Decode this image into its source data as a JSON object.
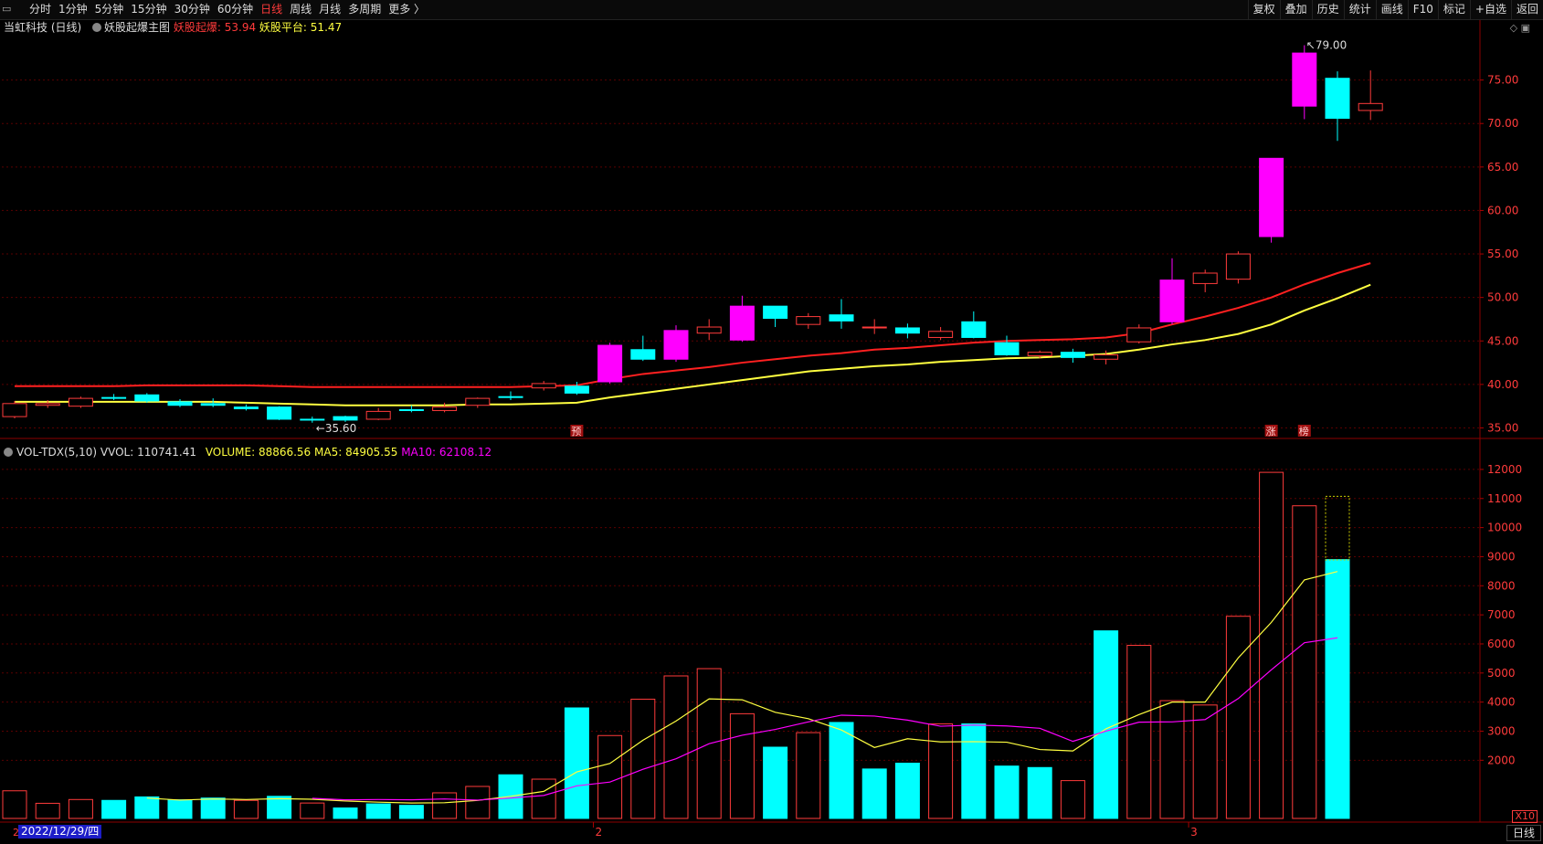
{
  "toolbar": {
    "periods": [
      "分时",
      "1分钟",
      "5分钟",
      "15分钟",
      "30分钟",
      "60分钟",
      "日线",
      "周线",
      "月线",
      "多周期",
      "更多 〉"
    ],
    "active_period": "日线",
    "right_tools": [
      "复权",
      "叠加",
      "历史",
      "统计",
      "画线",
      "F10",
      "标记",
      "+自选",
      "返回"
    ]
  },
  "main_legend": {
    "stock": "当虹科技 (日线)",
    "indicator": "妖股起爆主图",
    "line1_label": "妖股起爆:",
    "line1_value": "53.94",
    "line2_label": "妖股平台:",
    "line2_value": "51.47"
  },
  "volume_legend": {
    "name": "VOL-TDX(5,10)",
    "vvol_label": "VVOL:",
    "vvol_value": "110741.41",
    "volume_label": "VOLUME:",
    "volume_value": "88866.56",
    "ma5_label": "MA5:",
    "ma5_value": "84905.55",
    "ma10_label": "MA10:",
    "ma10_value": "62108.12"
  },
  "colors": {
    "up": "#ff3b3b",
    "down": "#00ffff",
    "big_up": "#ff00ff",
    "line1": "#ff2020",
    "line2": "#ffff40",
    "ma10": "#ff00ff"
  },
  "chart_data": [
    {
      "type": "candlestick",
      "title": "当虹科技 (日线)",
      "y_ticks": [
        "75.00",
        "70.00",
        "65.00",
        "60.00",
        "55.00",
        "50.00",
        "45.00",
        "40.00",
        "35.00"
      ],
      "ylim": [
        34,
        80
      ],
      "annotations": {
        "high_label": "79.00",
        "low_label": "35.60"
      },
      "markers": [
        {
          "index": 17,
          "text": "预"
        },
        {
          "index": 38,
          "text": "涨"
        },
        {
          "index": 39,
          "text": "榜"
        }
      ],
      "candles": [
        {
          "o": 36.3,
          "c": 37.8,
          "h": 38.1,
          "l": 36.1
        },
        {
          "o": 37.6,
          "c": 37.8,
          "h": 38.2,
          "l": 37.3
        },
        {
          "o": 37.5,
          "c": 38.4,
          "h": 38.6,
          "l": 37.3
        },
        {
          "o": 38.5,
          "c": 38.4,
          "h": 38.9,
          "l": 38.2
        },
        {
          "o": 38.8,
          "c": 38.1,
          "h": 39.0,
          "l": 37.9
        },
        {
          "o": 38.0,
          "c": 37.6,
          "h": 38.3,
          "l": 37.4
        },
        {
          "o": 37.8,
          "c": 37.6,
          "h": 38.4,
          "l": 37.4
        },
        {
          "o": 37.4,
          "c": 37.2,
          "h": 37.7,
          "l": 37.0
        },
        {
          "o": 37.4,
          "c": 36.0,
          "h": 37.5,
          "l": 35.9
        },
        {
          "o": 36.0,
          "c": 35.9,
          "h": 36.3,
          "l": 35.6
        },
        {
          "o": 36.3,
          "c": 35.9,
          "h": 36.4,
          "l": 35.7
        },
        {
          "o": 36.0,
          "c": 36.9,
          "h": 37.3,
          "l": 35.9
        },
        {
          "o": 37.1,
          "c": 37.0,
          "h": 37.6,
          "l": 36.8
        },
        {
          "o": 37.0,
          "c": 37.4,
          "h": 37.9,
          "l": 36.8
        },
        {
          "o": 37.6,
          "c": 38.4,
          "h": 38.5,
          "l": 37.3
        },
        {
          "o": 38.6,
          "c": 38.5,
          "h": 39.2,
          "l": 38.2
        },
        {
          "o": 39.6,
          "c": 40.1,
          "h": 40.4,
          "l": 39.3
        },
        {
          "o": 39.8,
          "c": 39.0,
          "h": 40.3,
          "l": 38.8
        },
        {
          "o": 40.3,
          "c": 44.5,
          "h": 44.8,
          "l": 40.1
        },
        {
          "o": 44.0,
          "c": 42.9,
          "h": 45.6,
          "l": 42.7
        },
        {
          "o": 42.9,
          "c": 46.2,
          "h": 46.8,
          "l": 42.6
        },
        {
          "o": 45.9,
          "c": 46.6,
          "h": 47.5,
          "l": 45.1
        },
        {
          "o": 45.1,
          "c": 49.0,
          "h": 50.2,
          "l": 44.9
        },
        {
          "o": 49.0,
          "c": 47.6,
          "h": 49.0,
          "l": 46.6
        },
        {
          "o": 46.9,
          "c": 47.8,
          "h": 48.2,
          "l": 46.4
        },
        {
          "o": 48.0,
          "c": 47.3,
          "h": 49.8,
          "l": 46.4
        },
        {
          "o": 46.6,
          "c": 46.6,
          "h": 47.5,
          "l": 45.8
        },
        {
          "o": 46.5,
          "c": 45.9,
          "h": 47.0,
          "l": 45.3
        },
        {
          "o": 45.4,
          "c": 46.1,
          "h": 46.6,
          "l": 45.1
        },
        {
          "o": 47.2,
          "c": 45.4,
          "h": 48.4,
          "l": 45.3
        },
        {
          "o": 44.8,
          "c": 43.4,
          "h": 45.6,
          "l": 43.3
        },
        {
          "o": 43.3,
          "c": 43.7,
          "h": 43.9,
          "l": 43.0
        },
        {
          "o": 43.7,
          "c": 43.1,
          "h": 44.1,
          "l": 42.5
        },
        {
          "o": 42.9,
          "c": 43.4,
          "h": 43.9,
          "l": 42.3
        },
        {
          "o": 44.9,
          "c": 46.5,
          "h": 46.9,
          "l": 44.7
        },
        {
          "o": 47.2,
          "c": 52.0,
          "h": 54.5,
          "l": 46.9
        },
        {
          "o": 51.6,
          "c": 52.8,
          "h": 53.2,
          "l": 50.6
        },
        {
          "o": 52.1,
          "c": 55.0,
          "h": 55.3,
          "l": 51.6
        },
        {
          "o": 57.0,
          "c": 66.0,
          "h": 66.0,
          "l": 56.3
        },
        {
          "o": 72.0,
          "c": 78.1,
          "h": 79.0,
          "l": 70.5
        },
        {
          "o": 75.2,
          "c": 70.6,
          "h": 76.0,
          "l": 68.0
        },
        {
          "o": 71.5,
          "c": 72.3,
          "h": 76.1,
          "l": 70.4
        }
      ],
      "series": [
        {
          "name": "妖股起爆",
          "values": [
            39.8,
            39.8,
            39.8,
            39.8,
            39.9,
            39.9,
            39.9,
            39.9,
            39.8,
            39.7,
            39.7,
            39.7,
            39.7,
            39.7,
            39.7,
            39.7,
            39.8,
            39.9,
            40.6,
            41.2,
            41.6,
            42.0,
            42.5,
            42.9,
            43.3,
            43.6,
            44.0,
            44.2,
            44.5,
            44.8,
            45.0,
            45.1,
            45.2,
            45.4,
            45.9,
            46.9,
            47.8,
            48.8,
            50.0,
            51.5,
            52.8,
            53.94
          ]
        },
        {
          "name": "妖股平台",
          "values": [
            38.0,
            38.0,
            38.0,
            38.0,
            38.0,
            38.0,
            38.0,
            37.9,
            37.8,
            37.7,
            37.6,
            37.6,
            37.6,
            37.6,
            37.7,
            37.7,
            37.8,
            37.9,
            38.5,
            39.0,
            39.5,
            40.0,
            40.5,
            41.0,
            41.5,
            41.8,
            42.1,
            42.3,
            42.6,
            42.8,
            43.0,
            43.1,
            43.3,
            43.5,
            44.0,
            44.6,
            45.1,
            45.8,
            46.9,
            48.5,
            49.9,
            51.47
          ]
        }
      ]
    },
    {
      "type": "bar",
      "title": "VOL-TDX(5,10)",
      "y_ticks": [
        "12000",
        "11000",
        "10000",
        "9000",
        "8000",
        "7000",
        "6000",
        "5000",
        "4000",
        "3000",
        "2000"
      ],
      "y_unit": "X10",
      "ylim": [
        0,
        12500
      ],
      "values": [
        950,
        520,
        650,
        620,
        740,
        640,
        700,
        620,
        760,
        530,
        360,
        500,
        450,
        880,
        1100,
        1500,
        1350,
        3800,
        2850,
        4100,
        4900,
        5150,
        3600,
        2450,
        2950,
        3300,
        1700,
        1900,
        3250,
        3250,
        1800,
        1750,
        1300,
        6450,
        5950,
        4050,
        3900,
        6950,
        11900,
        10750,
        8900
      ],
      "dir": [
        "up",
        "up",
        "up",
        "down",
        "down",
        "down",
        "down",
        "up",
        "down",
        "up",
        "down",
        "down",
        "down",
        "up",
        "up",
        "down",
        "up",
        "down",
        "up",
        "up",
        "up",
        "up",
        "up",
        "down",
        "up",
        "down",
        "down",
        "down",
        "up",
        "down",
        "down",
        "down",
        "up",
        "down",
        "up",
        "up",
        "up",
        "up",
        "up",
        "up",
        "down",
        "up"
      ],
      "current_bar": {
        "volume": 8886.656,
        "vvol": 11074.141
      },
      "series": [
        {
          "name": "MA5",
          "values": [
            null,
            null,
            null,
            null,
            700,
            630,
            670,
            650,
            680,
            660,
            600,
            560,
            530,
            540,
            620,
            760,
            930,
            1600,
            1890,
            2690,
            3350,
            4110,
            4080,
            3650,
            3430,
            3040,
            2440,
            2740,
            2630,
            2640,
            2620,
            2370,
            2320,
            3080,
            3570,
            4000,
            4000,
            5520,
            6740,
            8200,
            8491
          ]
        },
        {
          "name": "MA10",
          "values": [
            null,
            null,
            null,
            null,
            null,
            null,
            null,
            null,
            null,
            690,
            640,
            650,
            640,
            670,
            630,
            700,
            790,
            1120,
            1250,
            1690,
            2050,
            2570,
            2860,
            3060,
            3320,
            3550,
            3520,
            3380,
            3170,
            3210,
            3180,
            3100,
            2650,
            3000,
            3310,
            3320,
            3400,
            4120,
            5110,
            6040,
            6211
          ]
        }
      ]
    }
  ],
  "footer": {
    "date": "2022/12/29/四",
    "period": "日线",
    "month_marks": [
      "2",
      "3"
    ]
  }
}
